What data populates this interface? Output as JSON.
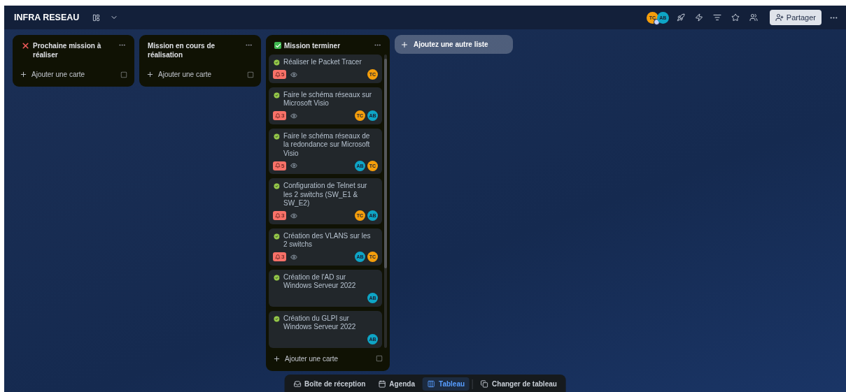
{
  "board": {
    "title": "INFRA RESEAU",
    "members": [
      {
        "initials": "TC",
        "color": "#f59e0b",
        "badge": true
      },
      {
        "initials": "AB",
        "color": "#0ea5c6",
        "badge": false
      }
    ],
    "share_label": "Partager"
  },
  "lists": [
    {
      "title": "Prochaine mission à réaliser",
      "kind": "todo",
      "add_label": "Ajouter une carte"
    },
    {
      "title": "Mission en cours de réalisation",
      "kind": "doing",
      "add_label": "Ajouter une carte"
    },
    {
      "title": "Mission terminer",
      "kind": "done",
      "add_label": "Ajouter une carte",
      "cards": [
        {
          "title": "Réaliser le Packet Tracer",
          "done": true,
          "notifications": "5",
          "watching": true,
          "members": [
            {
              "initials": "TC",
              "color": "#f59e0b"
            }
          ]
        },
        {
          "title": "Faire le schéma réseaux sur Microsoft Visio",
          "done": true,
          "notifications": "3",
          "watching": true,
          "members": [
            {
              "initials": "TC",
              "color": "#f59e0b"
            },
            {
              "initials": "AB",
              "color": "#0ea5c6"
            }
          ]
        },
        {
          "title": "Faire le schéma réseaux de la redondance sur Microsoft Visio",
          "done": true,
          "notifications": "5",
          "watching": true,
          "members": [
            {
              "initials": "AB",
              "color": "#0ea5c6"
            },
            {
              "initials": "TC",
              "color": "#f59e0b"
            }
          ]
        },
        {
          "title": "Configuration de Telnet sur les 2 switchs (SW_E1 & SW_E2)",
          "done": true,
          "notifications": "3",
          "watching": true,
          "members": [
            {
              "initials": "TC",
              "color": "#f59e0b"
            },
            {
              "initials": "AB",
              "color": "#0ea5c6"
            }
          ]
        },
        {
          "title": "Création des VLANS sur les 2 switchs",
          "done": true,
          "notifications": "3",
          "watching": true,
          "members": [
            {
              "initials": "AB",
              "color": "#0ea5c6"
            },
            {
              "initials": "TC",
              "color": "#f59e0b"
            }
          ]
        },
        {
          "title": "Création de l'AD sur Windows Serveur 2022",
          "done": true,
          "watching": false,
          "members": [
            {
              "initials": "AB",
              "color": "#0ea5c6"
            }
          ]
        },
        {
          "title": "Création du GLPI sur Windows Serveur 2022",
          "done": true,
          "watching": false,
          "members": [
            {
              "initials": "AB",
              "color": "#0ea5c6"
            }
          ]
        }
      ]
    }
  ],
  "add_list_label": "Ajoutez une autre liste",
  "bottom_nav": [
    {
      "label": "Boîte de réception",
      "selected": false
    },
    {
      "label": "Agenda",
      "selected": false
    },
    {
      "label": "Tableau",
      "selected": true
    },
    {
      "label": "Changer de tableau",
      "selected": false
    }
  ]
}
